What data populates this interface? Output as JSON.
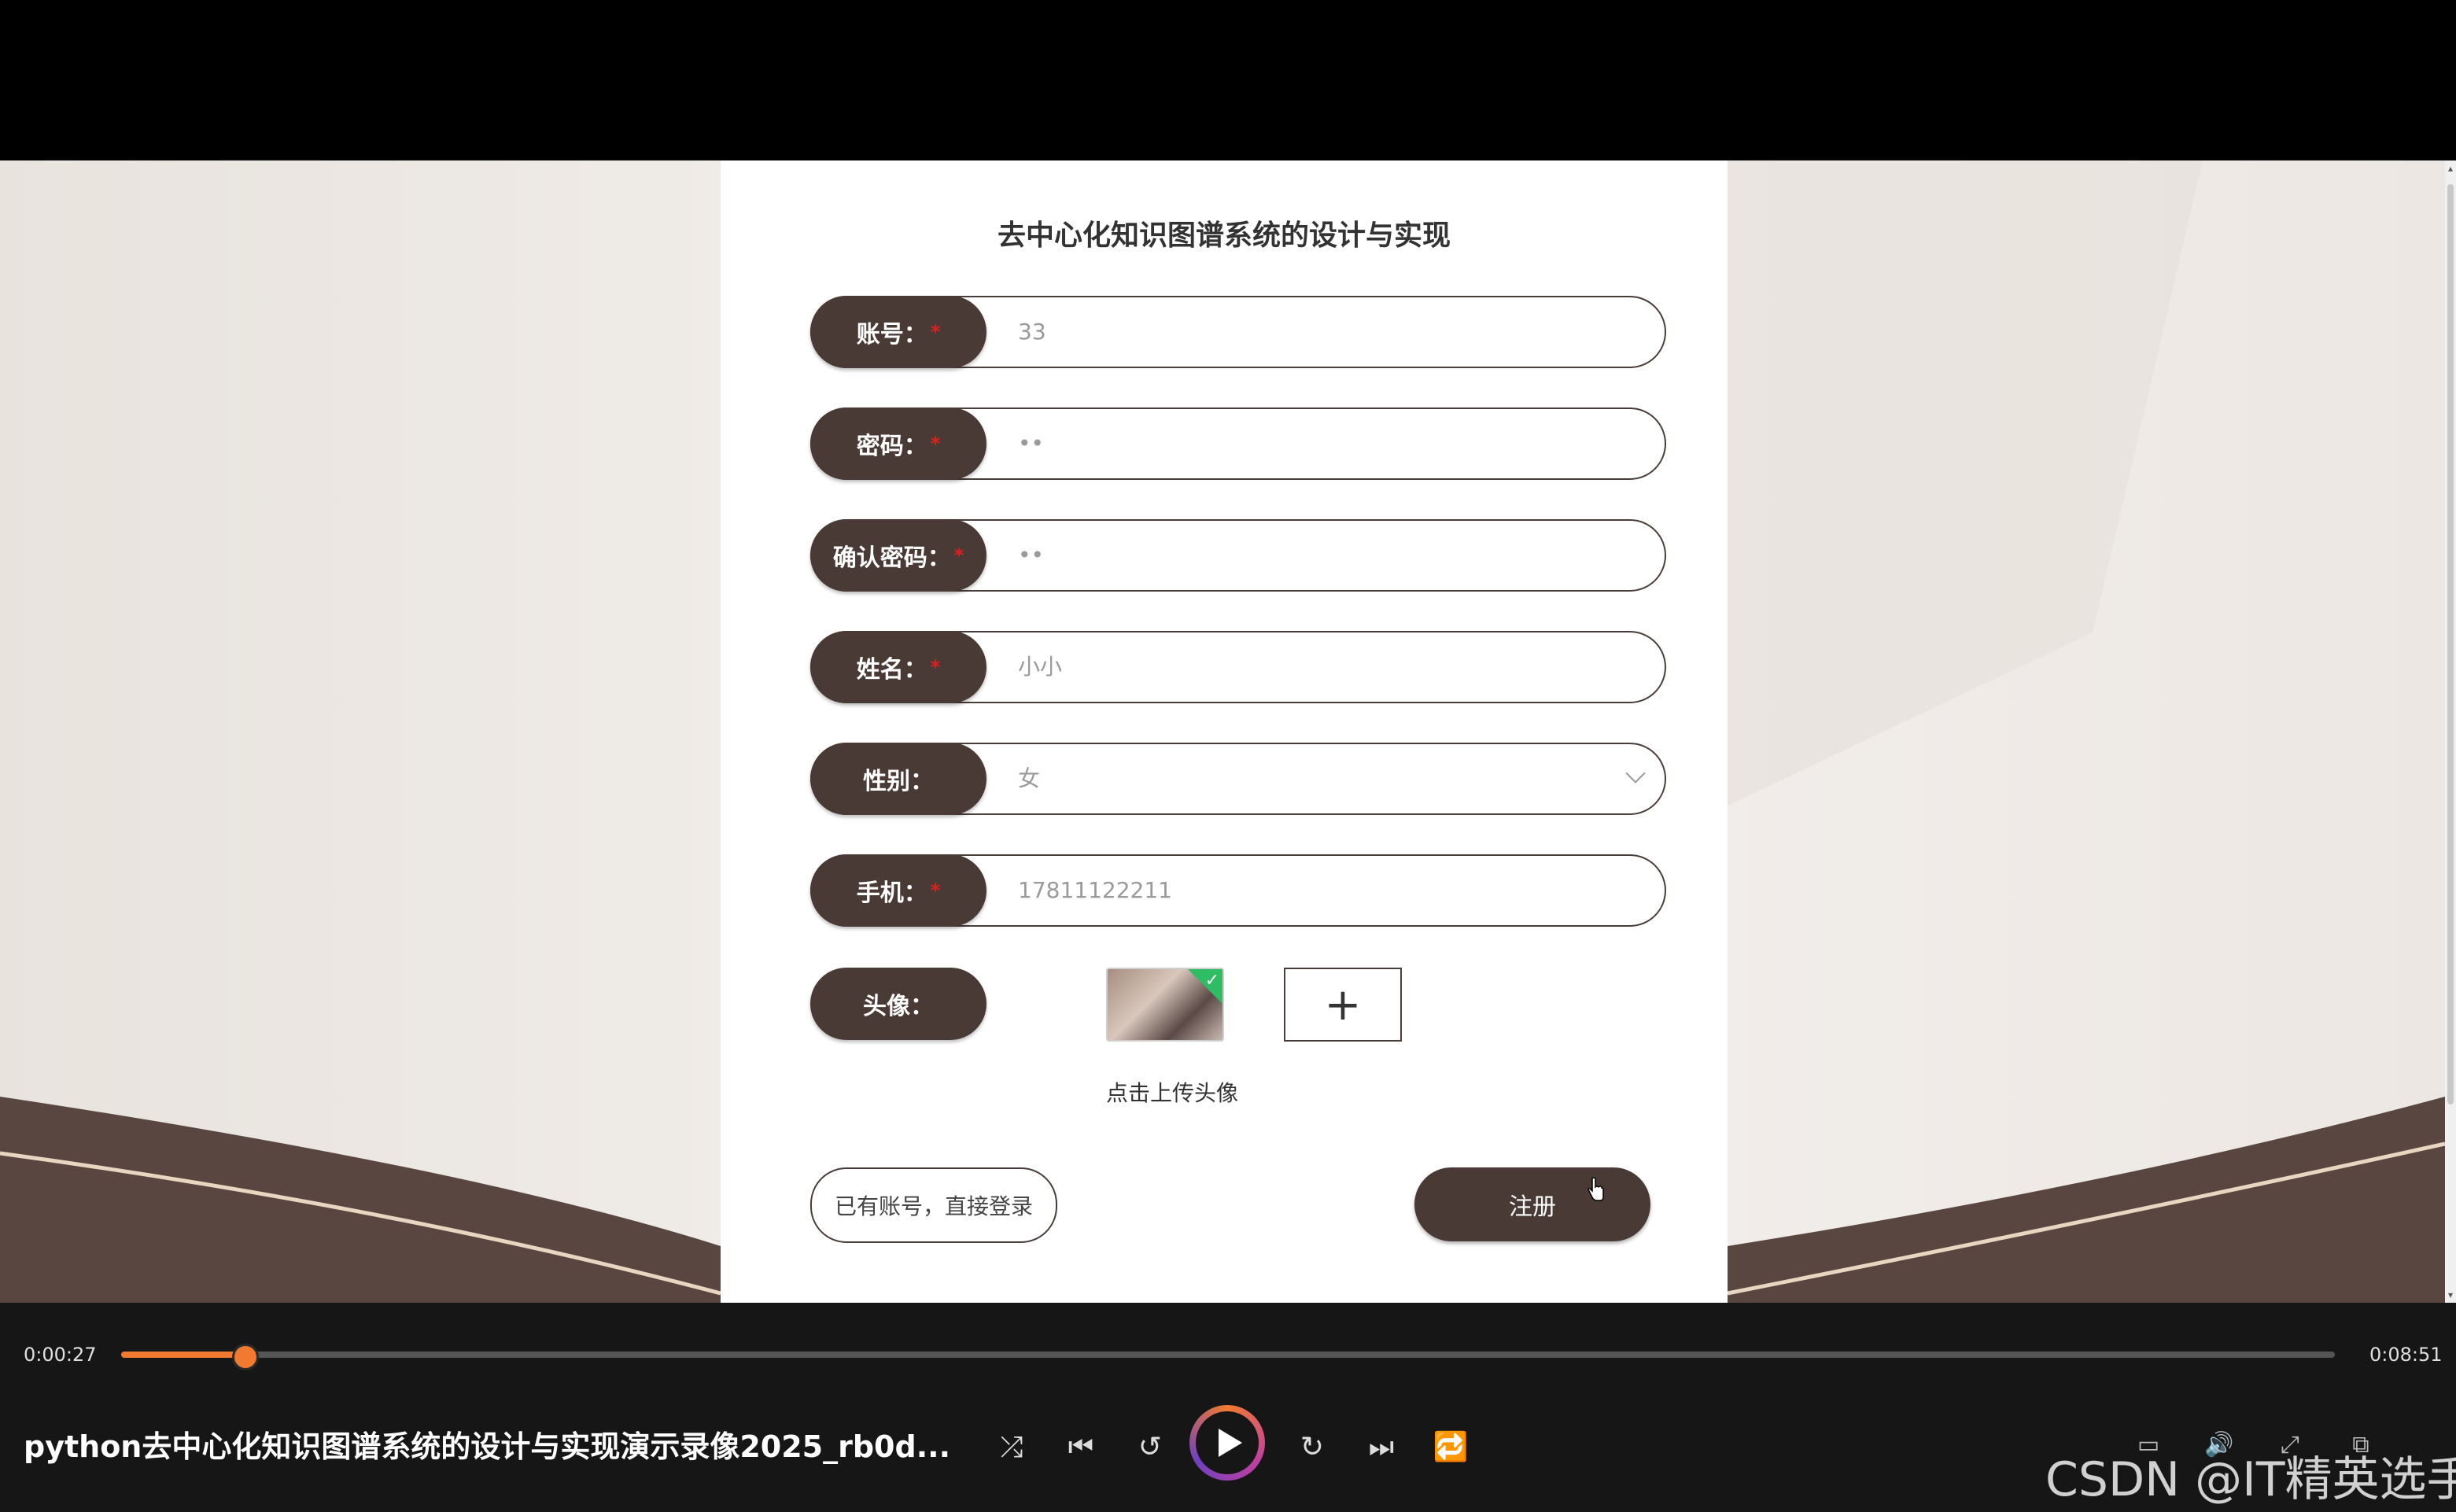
{
  "form": {
    "title": "去中心化知识图谱系统的设计与实现",
    "fields": [
      {
        "label": "账号：",
        "required": true,
        "value": "33"
      },
      {
        "label": "密码：",
        "required": true,
        "value": "••"
      },
      {
        "label": "确认密码：",
        "required": true,
        "value": "••"
      },
      {
        "label": "姓名：",
        "required": true,
        "value": "小小"
      },
      {
        "label": "性别：",
        "required": false,
        "value": "女"
      },
      {
        "label": "手机：",
        "required": true,
        "value": "17811122211"
      }
    ],
    "avatar_label": "头像：",
    "upload_hint": "点击上传头像",
    "upload_plus": "+",
    "required_mark": "*",
    "login_link": "已有账号，直接登录",
    "register_button": "注册"
  },
  "player": {
    "current_time": "0:00:27",
    "total_time": "0:08:51",
    "progress": 0.055,
    "title": "python去中心化知识图谱系统的设计与实现演示录像2025_rb0d...",
    "accent_color": "#f07a30"
  },
  "watermark": "CSDN @IT精英选手",
  "colors": {
    "pill": "#4a3a36",
    "required": "#e02020",
    "checked": "#2ebd62"
  }
}
